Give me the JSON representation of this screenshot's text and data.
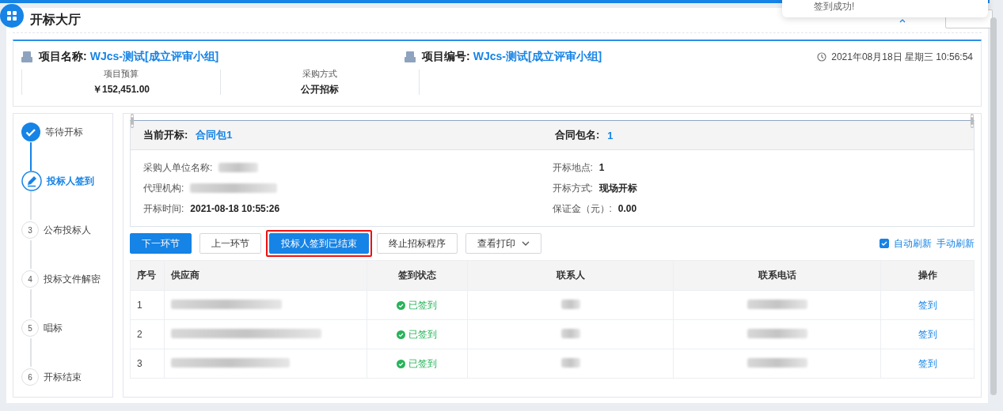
{
  "page": {
    "title": "开标大厅"
  },
  "toast": {
    "message": "签到成功!"
  },
  "project": {
    "name_label": "项目名称:",
    "name": "WJcs-测试[成立评审小组]",
    "code_label": "项目编号:",
    "code": "WJcs-测试[成立评审小组]",
    "datetime": "2021年08月18日 星期三 10:56:54",
    "stats": [
      {
        "label": "项目预算",
        "value": "￥152,451.00"
      },
      {
        "label": "采购方式",
        "value": "公开招标"
      }
    ]
  },
  "steps": [
    {
      "label": "等待开标",
      "kind": "done"
    },
    {
      "label": "投标人签到",
      "kind": "active"
    },
    {
      "label": "公布投标人",
      "kind": "pending",
      "number": "3"
    },
    {
      "label": "投标文件解密",
      "kind": "pending",
      "number": "4"
    },
    {
      "label": "唱标",
      "kind": "pending",
      "number": "5"
    },
    {
      "label": "开标结束",
      "kind": "pending",
      "number": "6"
    }
  ],
  "bid_info": {
    "current_label": "当前开标:",
    "current": "合同包1",
    "package_label": "合同包名:",
    "package": "1",
    "left_fields": [
      {
        "label": "采购人单位名称:"
      },
      {
        "label": "代理机构:"
      },
      {
        "label": "开标时间:",
        "value": "2021-08-18 10:55:26"
      }
    ],
    "right_fields": [
      {
        "label": "开标地点:",
        "value": "1"
      },
      {
        "label": "开标方式:",
        "value": "现场开标"
      },
      {
        "label": "保证金（元）:",
        "value": "0.00"
      }
    ]
  },
  "actions": [
    {
      "label": "下一环节",
      "kind": "primary",
      "highlighted": false
    },
    {
      "label": "上一环节",
      "kind": "default",
      "highlighted": false
    },
    {
      "label": "投标人签到已结束",
      "kind": "primary",
      "highlighted": true
    },
    {
      "label": "终止招标程序",
      "kind": "default",
      "highlighted": false
    },
    {
      "label": "查看打印",
      "kind": "dropdown",
      "highlighted": false
    }
  ],
  "auto_refresh": {
    "label": "自动刷新",
    "checked": true
  },
  "manual_refresh": "手动刷新",
  "table": {
    "columns": [
      "序号",
      "供应商",
      "签到状态",
      "联系人",
      "联系电话",
      "操作"
    ],
    "rows": [
      {
        "index": "1",
        "status": "已签到",
        "signed": true,
        "action": "签到"
      },
      {
        "index": "2",
        "status": "已签到",
        "signed": true,
        "action": "签到"
      },
      {
        "index": "3",
        "status": "已签到",
        "signed": true,
        "action": "签到"
      }
    ]
  }
}
